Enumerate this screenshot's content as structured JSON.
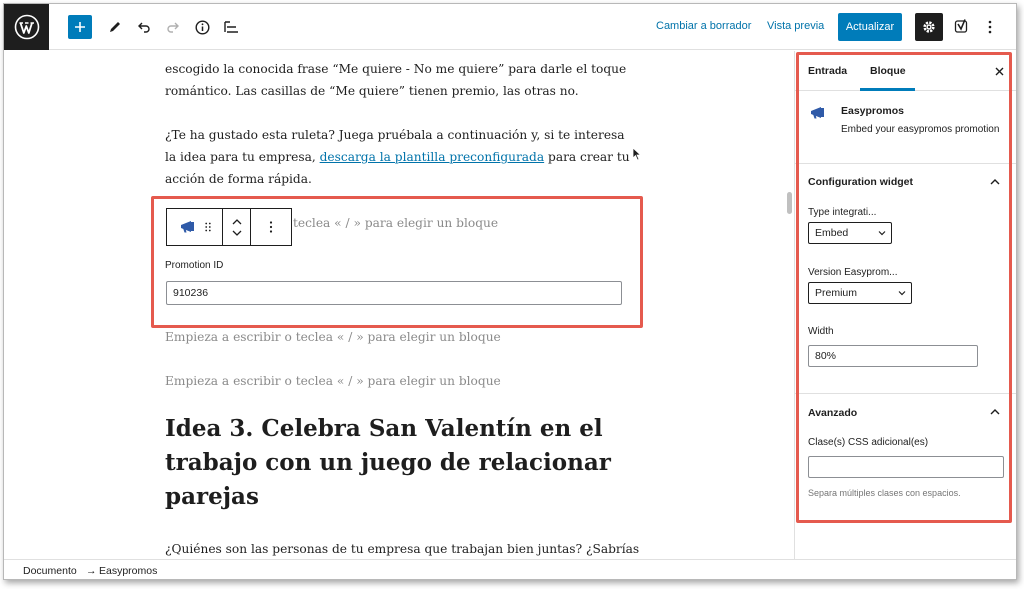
{
  "toolbar": {
    "switch_to_draft": "Cambiar a borrador",
    "preview": "Vista previa",
    "update": "Actualizar"
  },
  "content": {
    "para1": "escogido la conocida frase “Me quiere - No me quiere” para darle el toque romántico. Las casillas de “Me quiere” tienen premio, las otras no.",
    "para2_before": "¿Te ha gustado esta ruleta? Juega pruébala a continuación y, si te interesa la idea para tu empresa, ",
    "para2_link": "descarga la plantilla preconfigurada",
    "para2_after": " para crear tu acción de forma rápida.",
    "block_placeholder_partial": "teclea « / » para elegir un bloque",
    "promotion_id_label": "Promotion ID",
    "promotion_id_value": "910236",
    "placeholder1": "Empieza a escribir o teclea « / » para elegir un bloque",
    "placeholder2": "Empieza a escribir o teclea « / » para elegir un bloque",
    "heading": "Idea 3. Celebra San Valentín en el trabajo con un juego de relacionar parejas",
    "para3": "¿Quiénes son las personas de tu empresa que trabajan bien juntas? ¿Sabrías"
  },
  "sidebar": {
    "tab_post": "Entrada",
    "tab_block": "Bloque",
    "block_name": "Easypromos",
    "block_description": "Embed your easypromos promotion",
    "config_title": "Configuration widget",
    "type_label": "Type integrati...",
    "type_value": "Embed",
    "version_label": "Version Easyprom...",
    "version_value": "Premium",
    "width_label": "Width",
    "width_value": "80%",
    "advanced_title": "Avanzado",
    "css_label": "Clase(s) CSS adicional(es)",
    "css_value": "",
    "css_help": "Separa múltiples clases con espacios."
  },
  "statusbar": {
    "crumb_document": "Documento",
    "crumb_separator": "→",
    "crumb_block": "Easypromos"
  },
  "colors": {
    "accent": "#007cba",
    "highlight_border": "#e55a4e",
    "dark": "#1e1e1e",
    "link": "#0073aa"
  }
}
